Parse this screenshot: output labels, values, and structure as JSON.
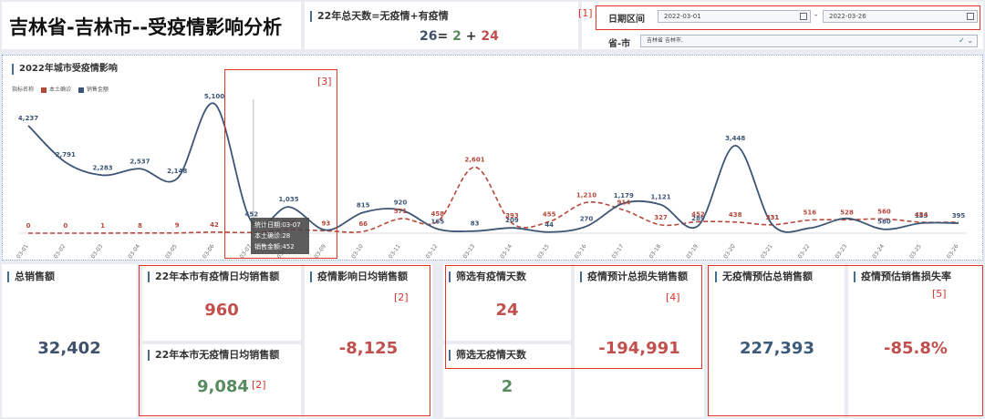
{
  "header": {
    "title": "吉林省-吉林市--受疫情影响分析",
    "total_days_label": "22年总天数=无疫情+有疫情",
    "total_days": "26",
    "eq": "=",
    "no_epidemic_days": "2",
    "plus": "+",
    "epidemic_days": "24",
    "date_label": "日期区间",
    "date_from": "2022-03-01",
    "date_sep": "-",
    "date_to": "2022-03-26",
    "province_label": "省-市",
    "province_value": "吉林省 吉林市,",
    "notes": {
      "n1": "[1]",
      "n2a": "[2]",
      "n2b": "[2]",
      "n3": "[3]",
      "n4": "[4]",
      "n5": "[5]"
    }
  },
  "chart_data": {
    "type": "line",
    "title": "2022年城市受疫情影响",
    "legend_title": "指标名称",
    "categories": [
      "03-01",
      "03-02",
      "03-03",
      "03-04",
      "03-05",
      "03-06",
      "03-07",
      "03-08",
      "03-09",
      "03-10",
      "03-11",
      "03-12",
      "03-13",
      "03-14",
      "03-15",
      "03-16",
      "03-17",
      "03-18",
      "03-19",
      "03-20",
      "03-21",
      "03-22",
      "03-23",
      "03-24",
      "03-25",
      "03-26"
    ],
    "series": [
      {
        "name": "本土确诊",
        "color": "#b5483a",
        "style": "dashed",
        "values": [
          0,
          0,
          1,
          8,
          9,
          42,
          28,
          134,
          93,
          66,
          571,
          458,
          2601,
          393,
          455,
          1210,
          914,
          327,
          452,
          438,
          331,
          516,
          528,
          560,
          434,
          434
        ]
      },
      {
        "name": "销售金额",
        "color": "#3d5575",
        "style": "solid",
        "values": [
          4237,
          2791,
          2283,
          2537,
          2148,
          5100,
          452,
          1035,
          120,
          815,
          920,
          165,
          83,
          209,
          44,
          270,
          1179,
          1121,
          289,
          3448,
          331,
          200,
          580,
          153,
          395,
          395
        ]
      }
    ],
    "labels_line": [
      "4,237",
      "2,791",
      "2,283",
      "2,537",
      "2,148",
      "5,100",
      "452",
      "1,035",
      "",
      "815",
      "920",
      "165",
      "83",
      "209",
      "44",
      "270",
      "1,179",
      "1,121",
      "289",
      "3,448",
      "331",
      "",
      "",
      "580",
      "153",
      "395"
    ],
    "labels_dash": [
      "0",
      "0",
      "1",
      "8",
      "9",
      "42",
      "",
      "134",
      "93",
      "66",
      "571",
      "458",
      "2,601",
      "393",
      "455",
      "1,210",
      "914",
      "327",
      "452",
      "438",
      "331",
      "516",
      "528",
      "560",
      "434",
      ""
    ],
    "tooltip": {
      "line1": "统计日期:03-07",
      "line2": "本土确诊:28",
      "line3": "销售金额:452"
    }
  },
  "kpis": {
    "total_sales_label": "总销售额",
    "total_sales": "32,402",
    "epi_avg_label": "22年本市有疫情日均销售额",
    "epi_avg": "960",
    "noepi_avg_label": "22年本市无疫情日均销售额",
    "noepi_avg": "9,084",
    "impact_label": "疫情影响日均销售额",
    "impact": "-8,125",
    "filter_epi_label": "筛选有疫情天数",
    "filter_epi": "24",
    "filter_noepi_label": "筛选无疫情天数",
    "filter_noepi": "2",
    "loss_label": "疫情预计总损失销售额",
    "loss": "-194,991",
    "est_total_label": "无疫情预估总销售额",
    "est_total": "227,393",
    "loss_rate_label": "疫情预估销售损失率",
    "loss_rate": "-85.8%"
  }
}
